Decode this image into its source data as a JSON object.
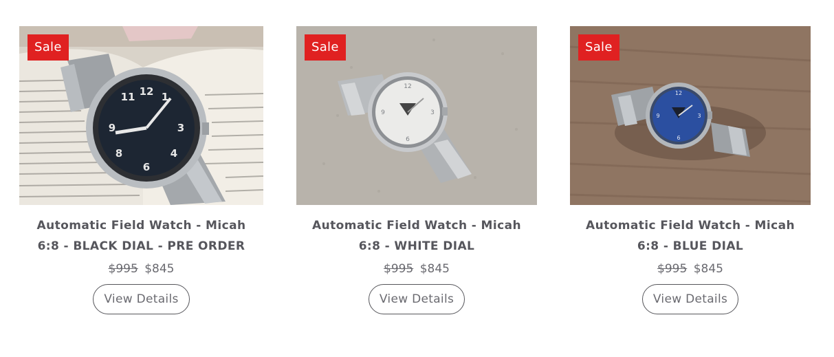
{
  "products": [
    {
      "badge": "Sale",
      "title": "Automatic Field Watch - Micah 6:8 - BLACK DIAL - PRE ORDER",
      "old_price": "$995",
      "price": "$845",
      "button_label": "View Details"
    },
    {
      "badge": "Sale",
      "title": "Automatic Field Watch - Micah 6:8 - WHITE DIAL",
      "old_price": "$995",
      "price": "$845",
      "button_label": "View Details"
    },
    {
      "badge": "Sale",
      "title": "Automatic Field Watch - Micah 6:8 - BLUE DIAL",
      "old_price": "$995",
      "price": "$845",
      "button_label": "View Details"
    }
  ],
  "colors": {
    "sale_badge": "#e02121",
    "text": "#56565c"
  }
}
